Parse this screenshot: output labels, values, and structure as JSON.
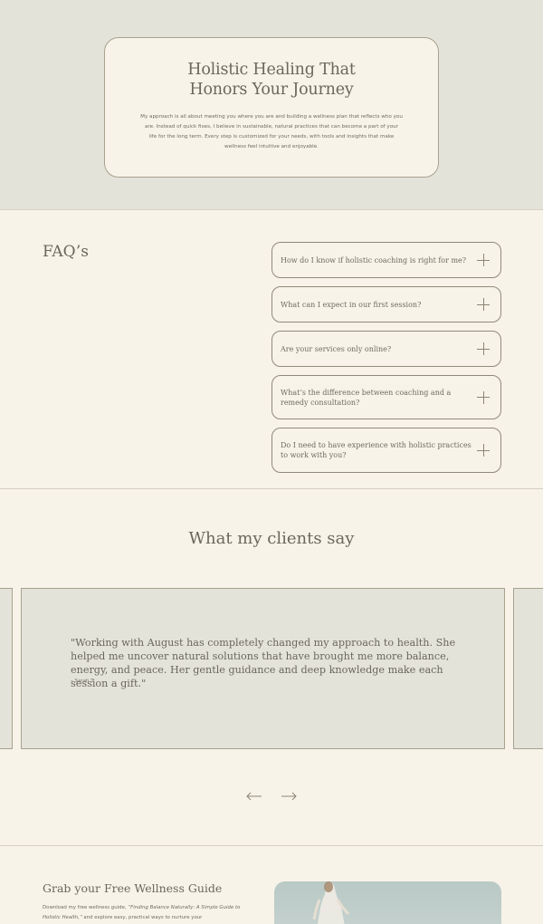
{
  "hero": {
    "title_line1": "Holistic Healing That",
    "title_line2": "Honors Your Journey",
    "body": "My approach is all about meeting you where you are and building a wellness plan that reflects who you are. Instead of quick fixes, I believe in sustainable, natural practices that can become a part of your life for the long term. Every step is customized for your needs, with tools and insights that make wellness feel intuitive and enjoyable."
  },
  "faq": {
    "title": "FAQ’s",
    "items": [
      {
        "question": "How do I know if holistic coaching is right for me?"
      },
      {
        "question": "What can I expect in our first session?"
      },
      {
        "question": "Are your services only online?"
      },
      {
        "question": "What’s the difference between coaching and a remedy consultation?"
      },
      {
        "question": "Do I need to have experience with holistic practices to work with you?"
      }
    ],
    "expand_icon": "plus-icon"
  },
  "testimonials": {
    "title": "What my clients say",
    "quote": "\"Working with August has completely changed my approach to health. She helped me uncover natural solutions that have brought me more balance, energy, and peace. Her gentle guidance and deep knowledge make each session a gift.\"",
    "author": "– Sarah T.",
    "prev_icon": "arrow-left-icon",
    "next_icon": "arrow-right-icon"
  },
  "guide": {
    "title": "Grab your Free Wellness Guide",
    "body_intro": "Download my free wellness guide, ",
    "body_book": "“Finding Balance Naturally: A Simple Guide to Holistic Health,”",
    "body_rest": " and explore easy, practical ways to nurture your"
  },
  "colors": {
    "page_bg": "#f7f3e8",
    "hero_bg": "#e4e3da",
    "border": "#a8a28f",
    "text": "#6a675b",
    "image_bg": "#b9c9c6"
  }
}
